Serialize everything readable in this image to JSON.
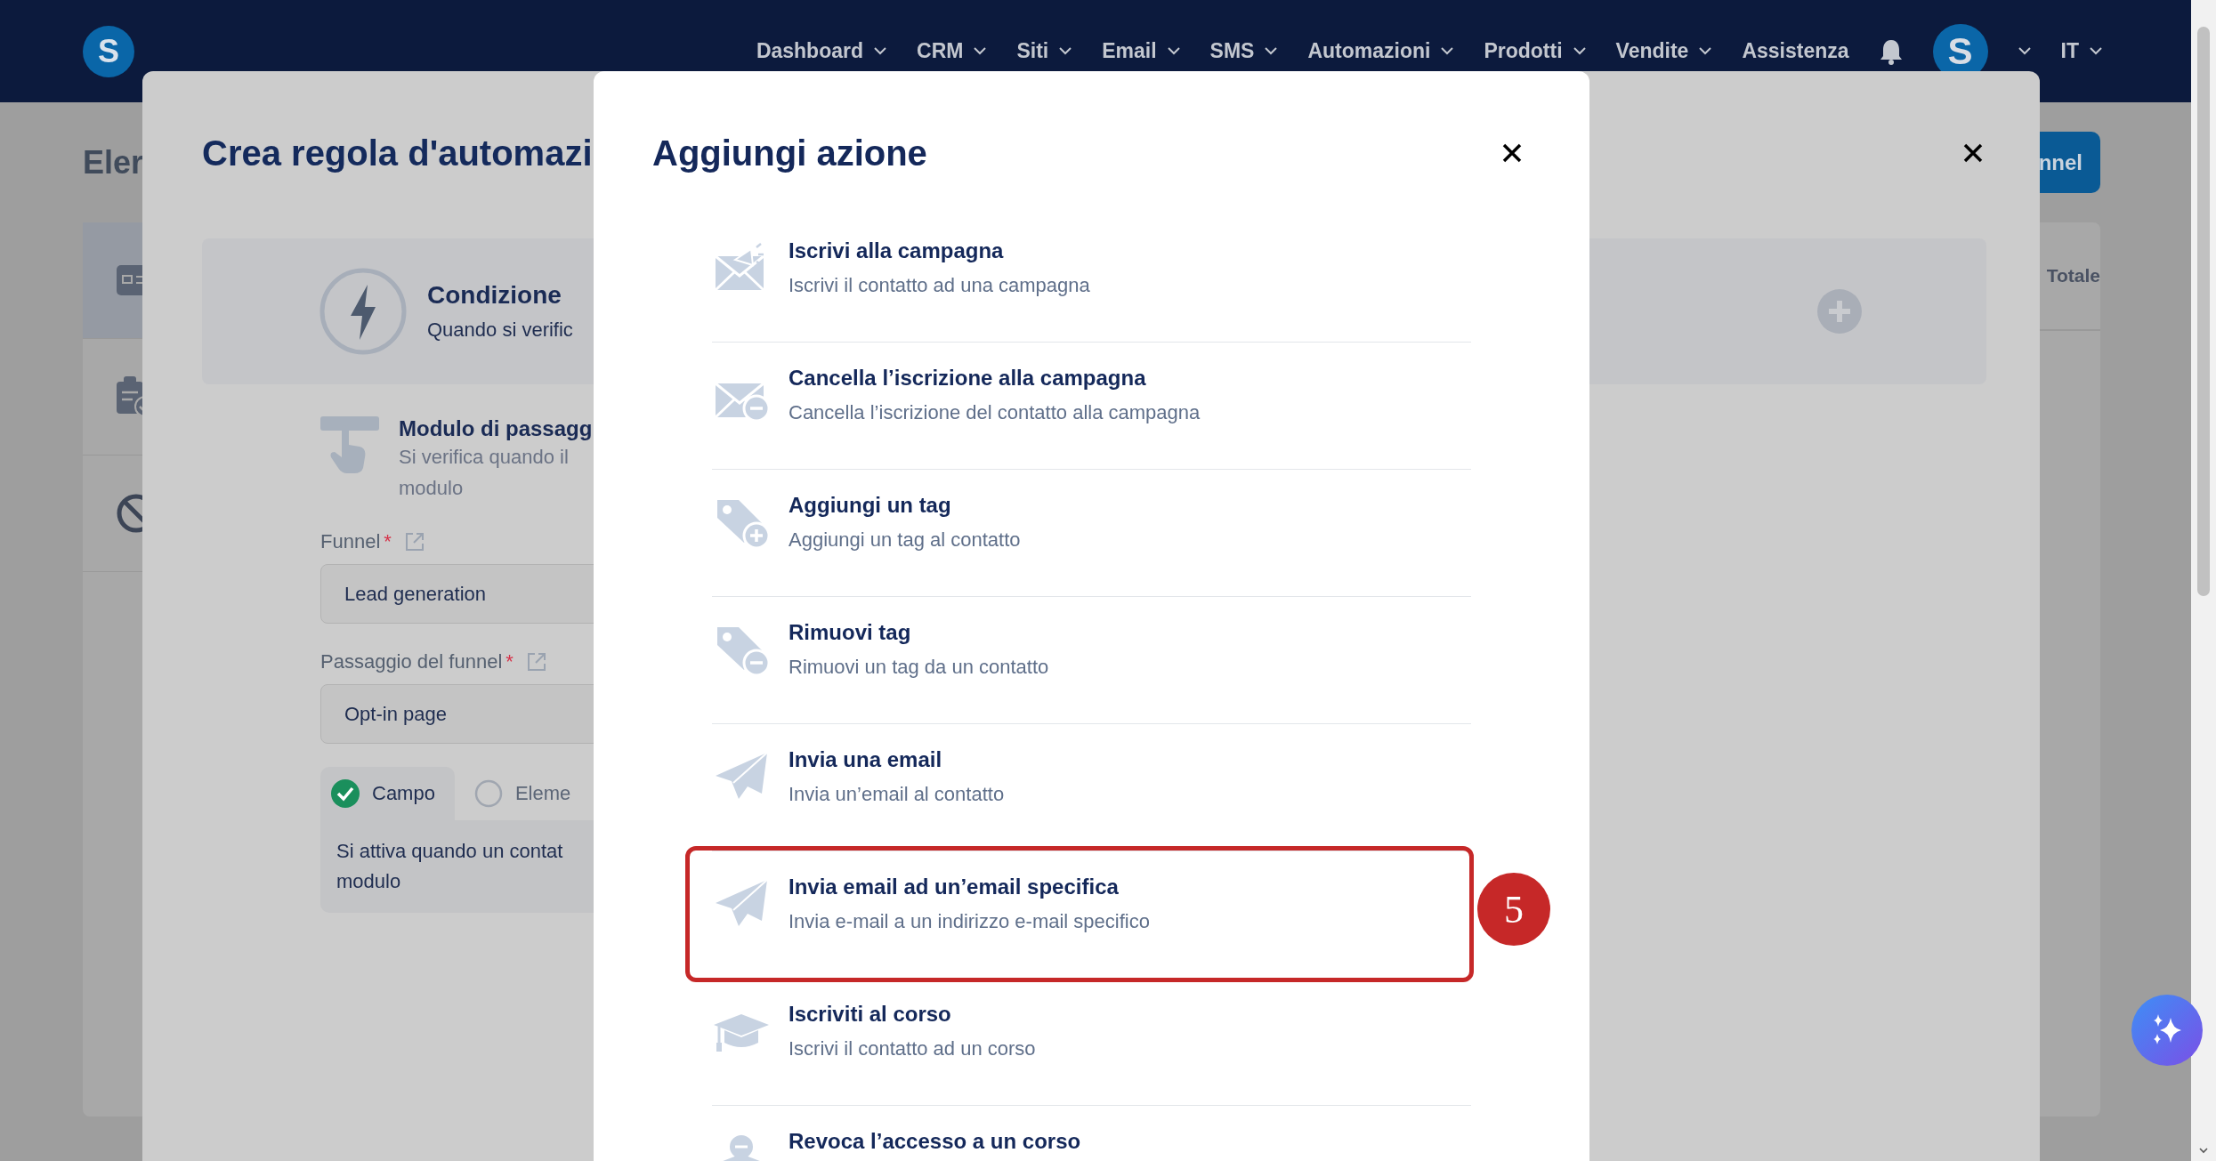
{
  "navbar": {
    "logo_letter": "S",
    "menu": [
      {
        "label": "Dashboard",
        "dropdown": true
      },
      {
        "label": "CRM",
        "dropdown": true
      },
      {
        "label": "Siti",
        "dropdown": true
      },
      {
        "label": "Email",
        "dropdown": true
      },
      {
        "label": "SMS",
        "dropdown": true
      },
      {
        "label": "Automazioni",
        "dropdown": true
      },
      {
        "label": "Prodotti",
        "dropdown": true
      },
      {
        "label": "Vendite",
        "dropdown": true
      },
      {
        "label": "Assistenza",
        "dropdown": false
      }
    ],
    "avatar_letter": "S",
    "language": "IT"
  },
  "background_page": {
    "title": "Eler",
    "button": "nnel",
    "column_header": "Totale",
    "sidebar_items": [
      {
        "kind": "card",
        "selected": true
      },
      {
        "kind": "clipboard",
        "selected": false
      },
      {
        "kind": "blocked",
        "selected": false
      }
    ]
  },
  "automation_modal": {
    "title": "Crea regola d'automazi",
    "condition": {
      "title": "Condizione",
      "subtitle": "Quando si verific"
    },
    "trigger": {
      "title": "Modulo di passagg",
      "description_lines": [
        "Si verifica quando il",
        "modulo"
      ]
    },
    "fields": [
      {
        "label": "Funnel",
        "required_mark": "*",
        "value": "Lead generation"
      },
      {
        "label": "Passaggio del funnel",
        "required_mark": "*",
        "value": "Opt-in page"
      }
    ],
    "options": [
      {
        "label": "Campo",
        "selected": true
      },
      {
        "label": "Eleme",
        "selected": false
      }
    ],
    "option_description_lines": [
      "Si attiva quando un contat",
      "modulo"
    ]
  },
  "action_modal": {
    "title": "Aggiungi azione",
    "actions": [
      {
        "kind": "campaign",
        "title": "Iscrivi alla campagna",
        "description": "Iscrivi il contatto ad una campagna",
        "highlighted": false
      },
      {
        "kind": "unsubscribe",
        "title": "Cancella l’iscrizione alla campagna",
        "description": "Cancella l’iscrizione del contatto alla campagna",
        "highlighted": false
      },
      {
        "kind": "tag-add",
        "title": "Aggiungi un tag",
        "description": "Aggiungi un tag al contatto",
        "highlighted": false
      },
      {
        "kind": "tag-remove",
        "title": "Rimuovi tag",
        "description": "Rimuovi un tag da un contatto",
        "highlighted": false
      },
      {
        "kind": "send",
        "title": "Invia una email",
        "description": "Invia un’email al contatto",
        "highlighted": false
      },
      {
        "kind": "send",
        "title": "Invia email ad un’email specifica",
        "description": "Invia e-mail a un indirizzo e-mail specifico",
        "highlighted": true,
        "callout": "5"
      },
      {
        "kind": "course",
        "title": "Iscriviti al corso",
        "description": "Iscrivi il contatto ad un corso",
        "highlighted": false
      },
      {
        "kind": "course-revoke",
        "title": "Revoca l’accesso a un corso",
        "highlighted": false
      }
    ]
  }
}
